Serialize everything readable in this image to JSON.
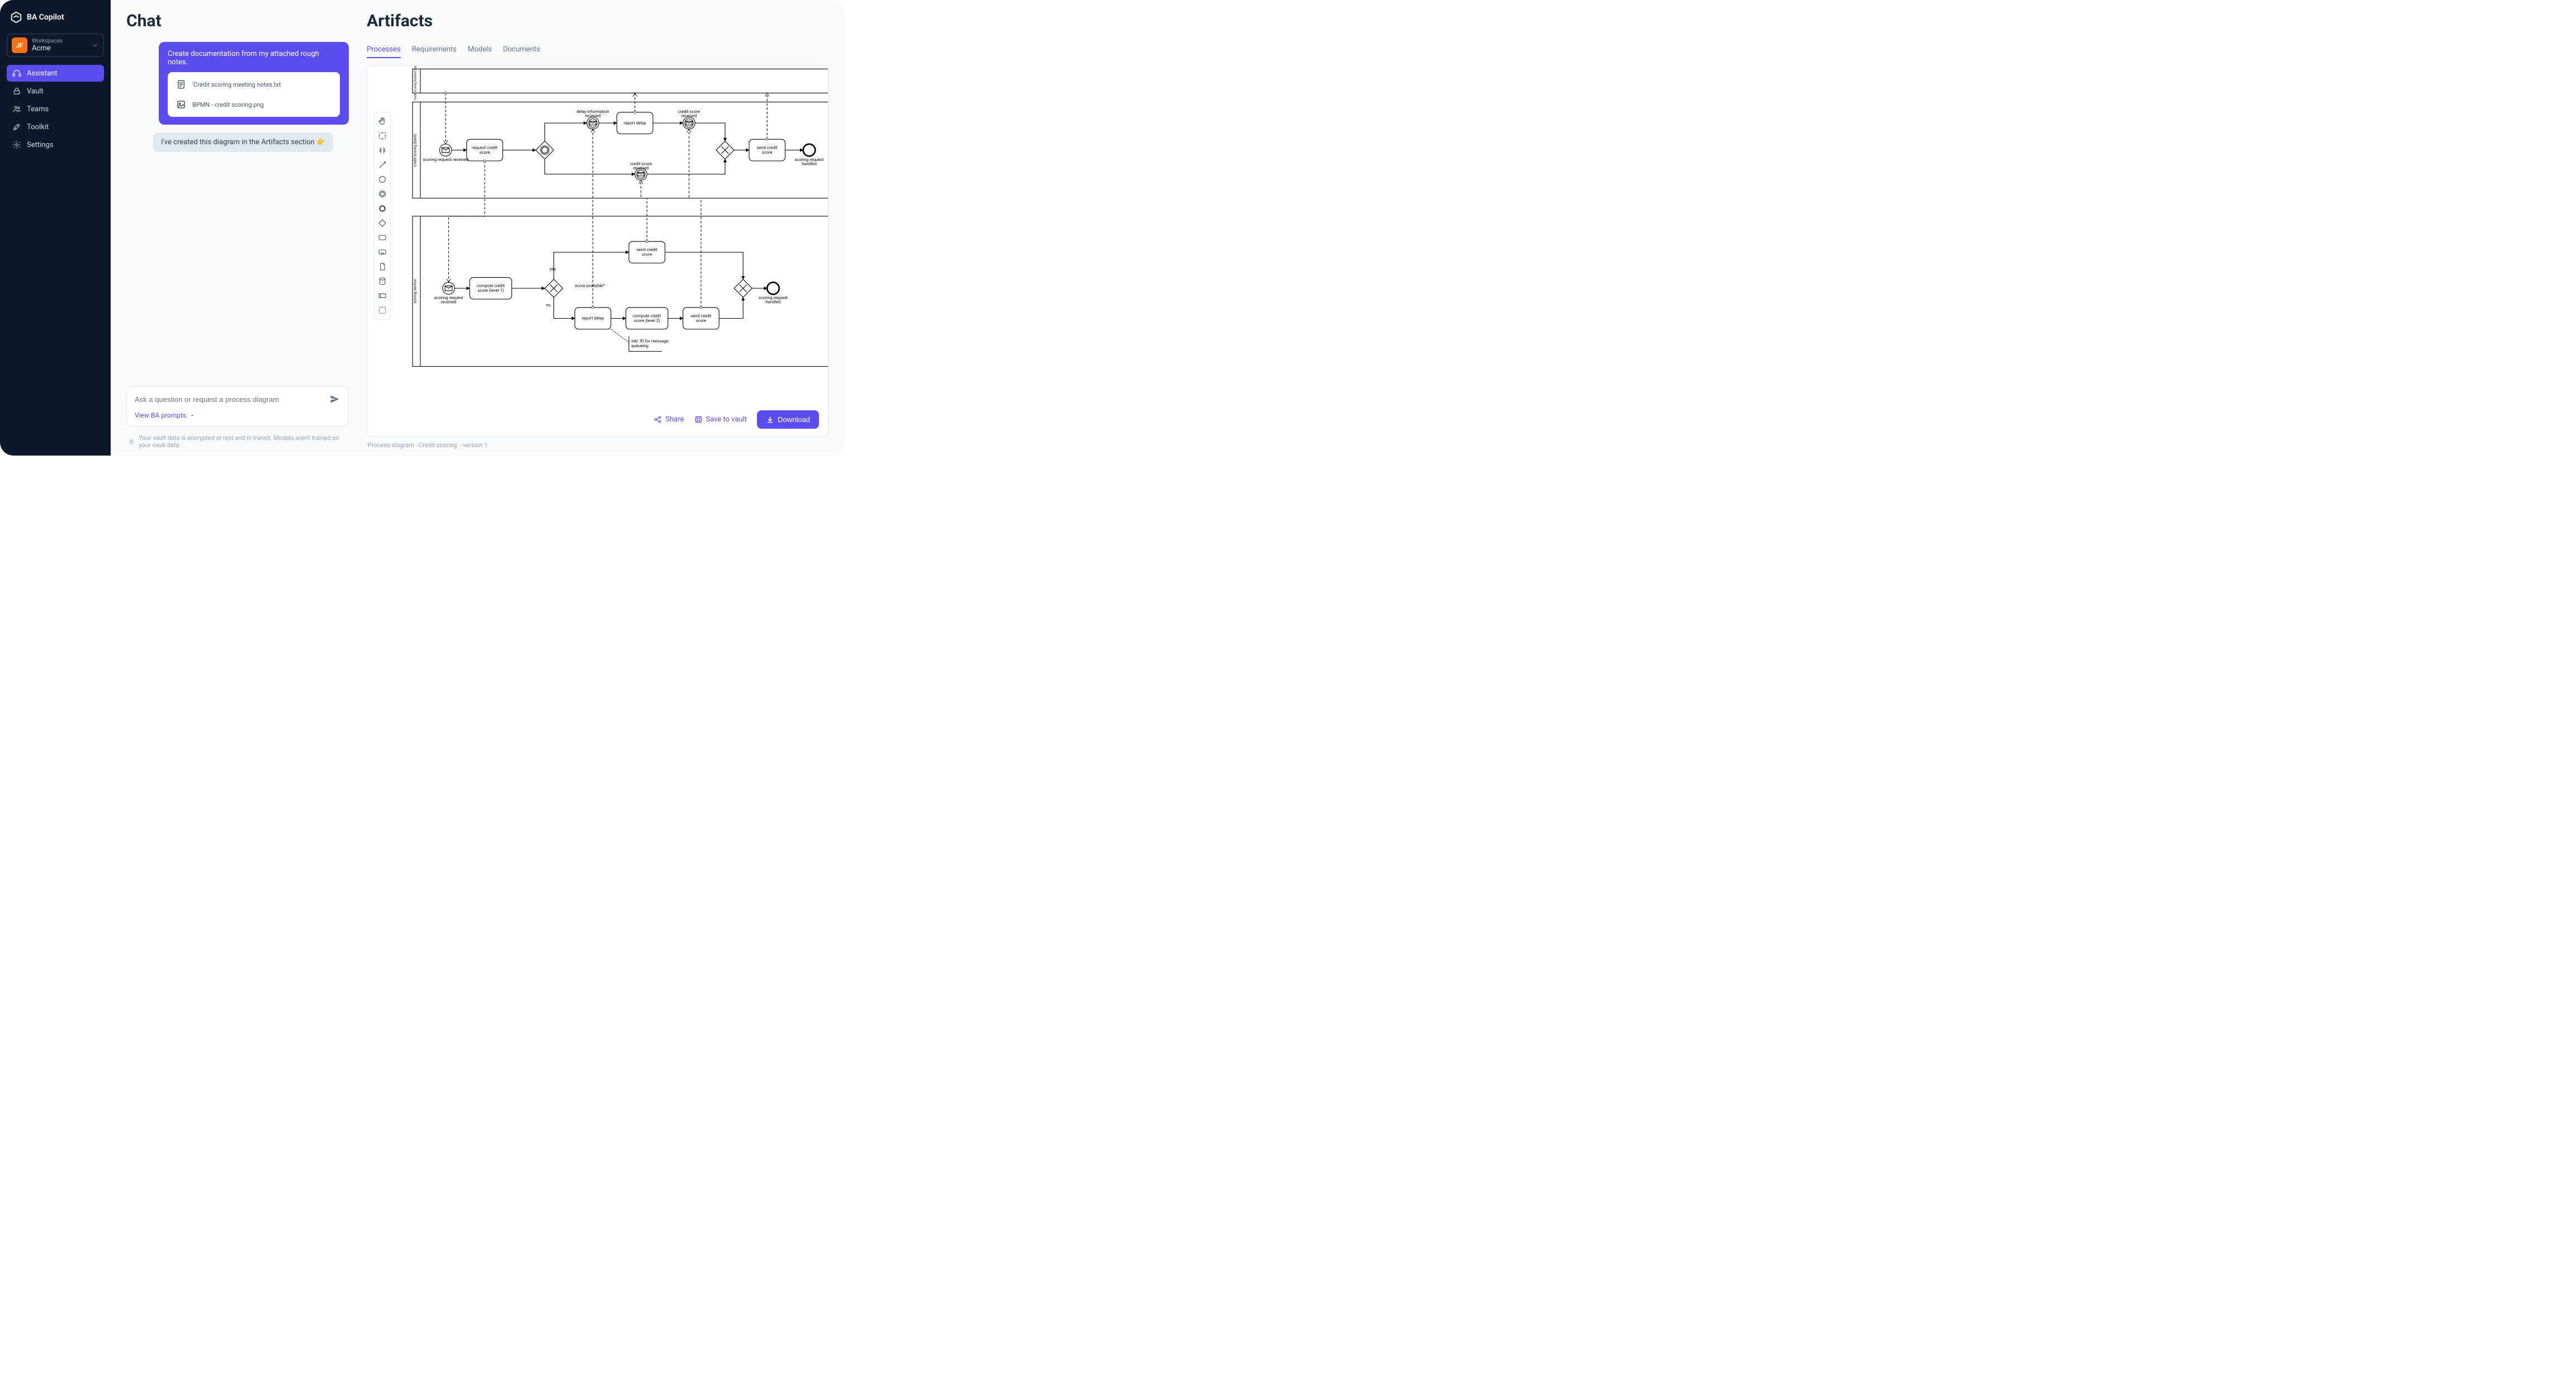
{
  "brand": {
    "name": "BA Copilot"
  },
  "workspace": {
    "label": "Workspaces",
    "name": "Acme",
    "avatar": "JF"
  },
  "nav": {
    "items": [
      {
        "label": "Assistant",
        "active": true
      },
      {
        "label": "Vault"
      },
      {
        "label": "Teams"
      },
      {
        "label": "Toolkit"
      },
      {
        "label": "Settings"
      }
    ]
  },
  "chat": {
    "title": "Chat",
    "user_message": "Create documentation from my attached rough notes.",
    "attachments": [
      {
        "name": "'Credit scoring meeting notes.txt",
        "kind": "text"
      },
      {
        "name": "BPMN - credit scoring.png",
        "kind": "image"
      }
    ],
    "assistant_message": "I've created this diagram in the Artifacts section 👉",
    "input_placeholder": "Ask a question or request a process diagram",
    "prompts_link": "View BA prompts",
    "footer_note": "Your vault data is encrypted at rest and in transit. Models aren't trained on your vault data."
  },
  "artifacts": {
    "title": "Artifacts",
    "tabs": [
      {
        "label": "Processes",
        "active": true
      },
      {
        "label": "Requirements"
      },
      {
        "label": "Models"
      },
      {
        "label": "Documents"
      }
    ],
    "actions": {
      "share": "Share",
      "save": "Save to vault",
      "download": "Download"
    },
    "caption": "'Process diagram - Credit scoring' - version 1",
    "diagram": {
      "lanes": [
        "credit scoring fontend (bank)",
        "credit scoring (bank)",
        "scoring service"
      ],
      "pool1_nodes": {
        "start": "scoring request received",
        "task_request": "request credit score",
        "msg_delay": "delay information received",
        "task_report_delay": "report delay",
        "msg_score": "credit score received",
        "msg_score2": "credit score received",
        "task_send": "send credit score",
        "end": "scoring request handled"
      },
      "pool2_nodes": {
        "start": "scoring request received",
        "task_compute1": "compute credit score (level 1)",
        "gateway_label": "score available?",
        "yes": "yes",
        "no": "no",
        "task_send_top": "send credit score",
        "task_report_delay": "report delay",
        "task_compute2": "compute credit score (level 2)",
        "task_send_bottom": "send credit score",
        "annotation": "inkl. ID for message queueing",
        "end": "scoring request handled"
      }
    }
  }
}
